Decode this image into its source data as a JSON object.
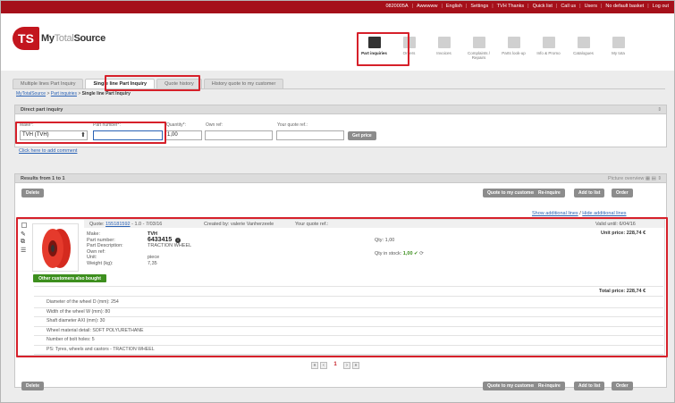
{
  "topbar": {
    "links": [
      "0820005A",
      "Awwwww",
      "English",
      "Settings",
      "TVH Thanks",
      "Quick list",
      "Call us",
      "Users",
      "No default basket",
      "Log out"
    ]
  },
  "logo": {
    "badge": "TS",
    "name_bold": "My",
    "name_light": "Total",
    "name_end": "Source"
  },
  "nav": {
    "items": [
      {
        "label": "Part inquiries",
        "icon": "envelope-icon",
        "active": true
      },
      {
        "label": "Orders",
        "icon": "folder-icon"
      },
      {
        "label": "Invoices",
        "icon": "document-icon"
      },
      {
        "label": "Complaints / Repairs",
        "icon": "tools-icon"
      },
      {
        "label": "Parts look-up",
        "icon": "magnifier-icon"
      },
      {
        "label": "Info & Promo",
        "icon": "chart-icon"
      },
      {
        "label": "Catalogues",
        "icon": "book-icon"
      },
      {
        "label": "My tota",
        "icon": "doc-icon"
      }
    ]
  },
  "tabs": [
    "Multiple lines Part Inquiry",
    "Single line Part Inquiry",
    "Quote history",
    "History quote to my customer"
  ],
  "breadcrumb": {
    "root": "MyTotalSource",
    "mid": "Part inquiries",
    "current": "Single line Part Inquiry"
  },
  "direct": {
    "title": "Direct part inquiry",
    "make_label": "Make*:",
    "make_value": "TVH (TVH)",
    "part_label": "Part number*:",
    "part_value": "",
    "qty_label": "Quantity*:",
    "qty_value": "1,00",
    "own_label": "Own ref:",
    "own_value": "",
    "quote_label": "Your quote ref.:",
    "quote_value": "",
    "get_price": "Get price",
    "comment_link": "Click here to add comment"
  },
  "results": {
    "title": "Results from 1 to 1",
    "overview": "Picture overview",
    "delete": "Delete",
    "actions": [
      "Quote to my customer",
      "Re-inquire",
      "Add to list",
      "Order"
    ],
    "show_lines": "Show additional lines",
    "hide_lines": "Hide additional lines",
    "item": {
      "quote_label": "Quote:",
      "quote_no": "155181592",
      "quote_rest": "- 1.0 - 7/03/16",
      "created": "Created by: valerie Vanherzeele",
      "your_quote": "Your quote ref.:",
      "valid": "Valid until: 6/04/16",
      "labels": [
        "Make:",
        "Part number:",
        "Part Description:",
        "Own ref:",
        "Unit:",
        "Weight (kg):"
      ],
      "values": [
        "TVH",
        "6433415",
        "TRACTION WHEEL",
        "",
        "piece",
        "7,35"
      ],
      "qty": "Qty: 1,00",
      "stock_label": "Qty in stock:",
      "stock_value": "1,00",
      "unit_price": "Unit price: 228,74 €",
      "total_price": "Total price: 228,74 €",
      "badge": "Other customers also bought",
      "specs": [
        "Diameter of the wheel D (mm): 254",
        "Width of the wheel W (mm): 80",
        "Shaft diameter AXI (mm): 30",
        "Wheel material detail: SOFT POLYURETHANE",
        "Number of bolt holes: 5",
        "PS: Tyres, wheels and castors - TRACTION WHEEL"
      ]
    },
    "pager": {
      "page": "1"
    }
  },
  "colors": {
    "brand": "#a5101a",
    "highlight": "#d6202a",
    "badge": "#3d8f1e"
  }
}
